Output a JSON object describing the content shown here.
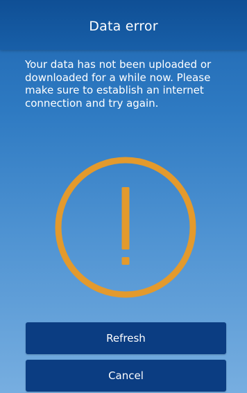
{
  "header": {
    "title": "Data error"
  },
  "message": {
    "text": "Your data has not been uploaded or downloaded for a while now. Please make sure to establish an internet connection and try again."
  },
  "icon": {
    "name": "warning-exclamation-icon",
    "color": "#e39a2d"
  },
  "actions": {
    "refresh_label": "Refresh",
    "cancel_label": "Cancel"
  },
  "colors": {
    "header": "#0f4f95",
    "button": "#0b3d82",
    "background_top": "#2e7ac2",
    "background_bottom": "#77aee0"
  }
}
